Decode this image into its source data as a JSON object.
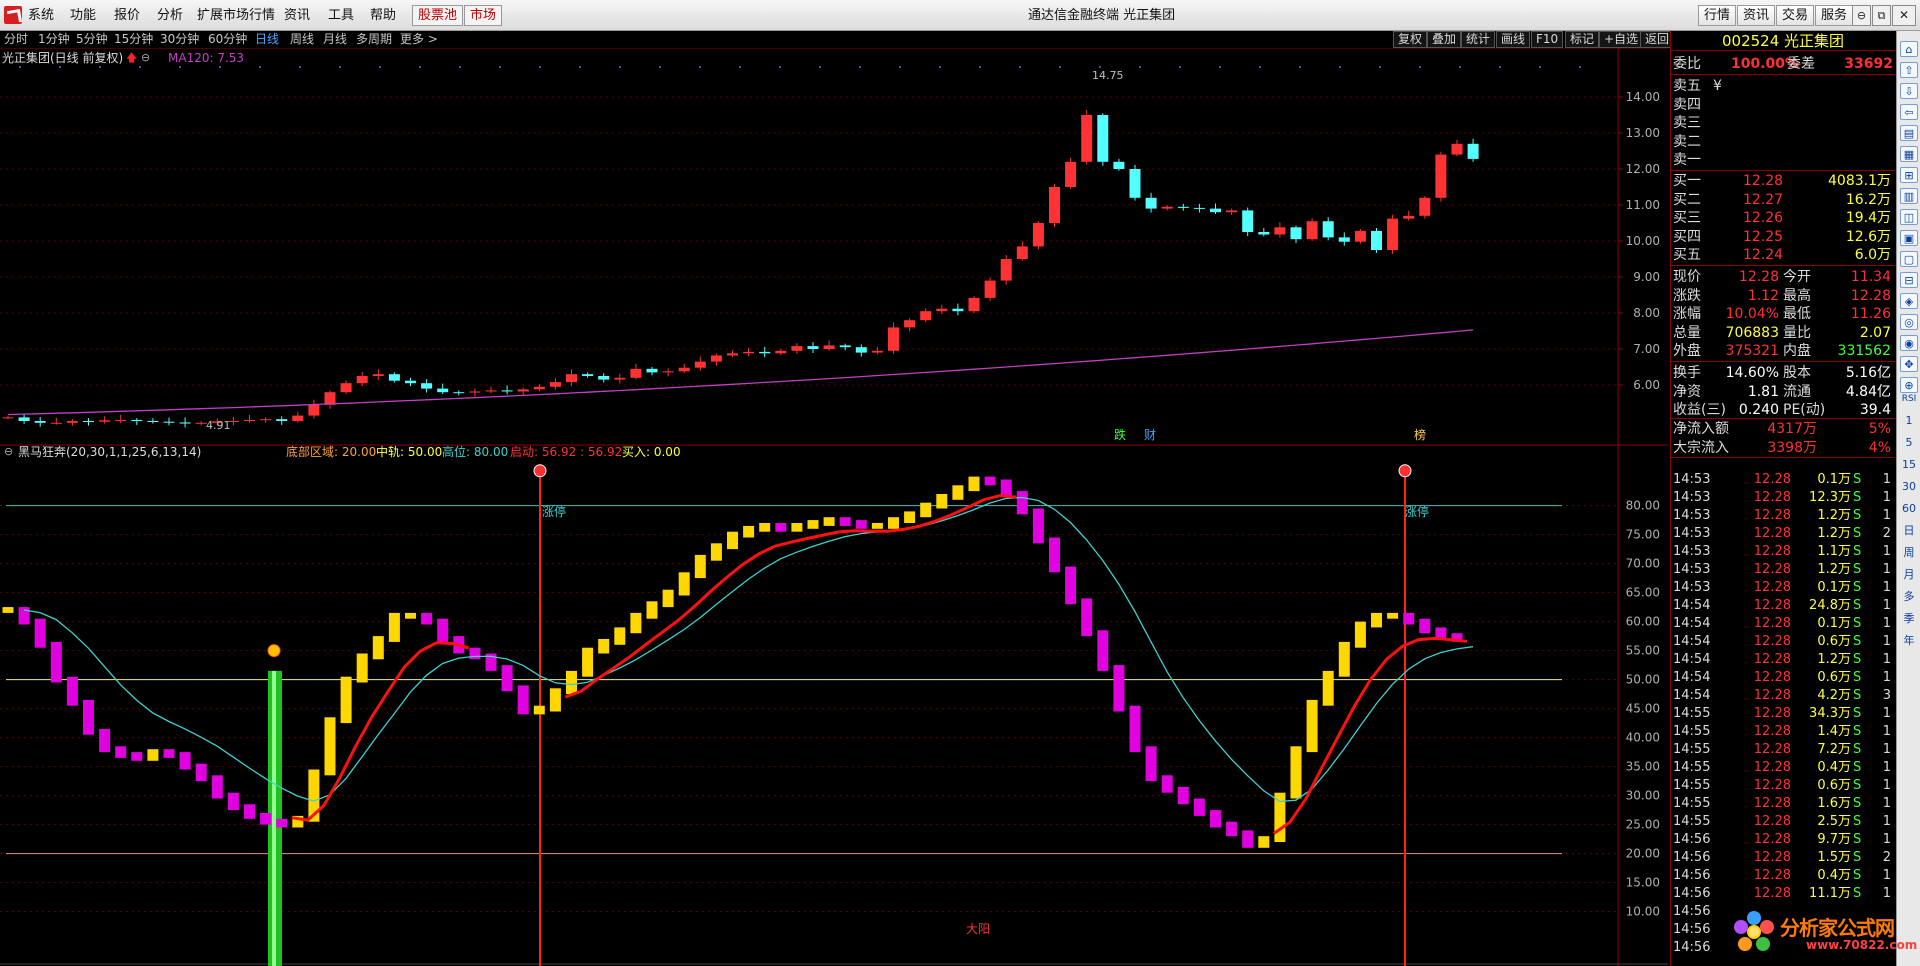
{
  "menubar": {
    "items": [
      "系统",
      "功能",
      "报价",
      "分析",
      "扩展市场行情",
      "资讯",
      "工具",
      "帮助"
    ],
    "pool_label": "股票池",
    "market_label": "市场",
    "window_title": "通达信金融终端  光正集团",
    "right_buttons": [
      "行情",
      "资讯",
      "交易",
      "服务"
    ]
  },
  "periods": {
    "items": [
      "分时",
      "1分钟",
      "5分钟",
      "15分钟",
      "30分钟",
      "60分钟",
      "日线",
      "周线",
      "月线",
      "多周期",
      "更多 >"
    ],
    "active": "日线"
  },
  "tools": [
    "复权",
    "叠加",
    "统计",
    "画线",
    "F10",
    "标记",
    "+自选",
    "返回"
  ],
  "main_header": {
    "stock": "光正集团(日线 前复权)",
    "ma": "MA120: 7.53"
  },
  "annotations": {
    "high": "14.75",
    "low": "4.91",
    "markers": [
      "跌",
      "财",
      "榜"
    ]
  },
  "indicator": {
    "name": "黑马狂奔(20,30,1,1,25,6,13,14)",
    "bottom_label": "底部区域: 20.00",
    "mid_label": "中轨: 50.00",
    "high_label": "高位: 80.00",
    "launch_label": "启动: 56.92 : 56.92",
    "buy_label": "买入: 0.00",
    "limit_up": "涨停",
    "big_yang": "大阳"
  },
  "colors": {
    "up": "#ff3333",
    "down": "#54ffff",
    "ma120": "#c040c0",
    "yellow": "#ffd700",
    "magenta": "#e000e0",
    "red_line": "#ff1010",
    "cyan_line": "#40d0d0"
  },
  "chart_data": [
    {
      "type": "candlestick",
      "title": "光正集团(日线 前复权)",
      "yaxis_ticks": [
        "14.00",
        "13.00",
        "12.00",
        "11.00",
        "10.00",
        "9.00",
        "8.00",
        "7.00",
        "6.00"
      ],
      "ylim": [
        5.4,
        14.9
      ],
      "series": [
        {
          "name": "K线",
          "close": [
            5.1,
            5.0,
            4.95,
            4.95,
            5.0,
            4.98,
            5.02,
            5.03,
            5.0,
            4.98,
            4.96,
            4.93,
            4.95,
            4.99,
            5.0,
            5.03,
            5.05,
            5.0,
            5.15,
            5.45,
            5.8,
            6.05,
            6.25,
            6.3,
            6.12,
            6.05,
            5.9,
            5.8,
            5.79,
            5.82,
            5.85,
            5.82,
            5.88,
            5.95,
            6.08,
            6.3,
            6.25,
            6.15,
            6.2,
            6.45,
            6.35,
            6.38,
            6.48,
            6.65,
            6.82,
            6.88,
            6.92,
            6.88,
            6.95,
            7.08,
            7.0,
            7.1,
            7.05,
            6.9,
            6.95,
            7.6,
            7.8,
            8.05,
            8.12,
            8.05,
            8.42,
            8.9,
            9.5,
            9.85,
            10.5,
            11.5,
            12.2,
            13.5,
            12.2,
            12.0,
            11.2,
            10.9,
            10.95,
            10.92,
            10.9,
            10.8,
            10.85,
            10.25,
            10.18,
            10.38,
            10.05,
            10.55,
            10.1,
            9.98,
            10.28,
            9.75,
            10.62,
            10.7,
            11.2,
            12.4,
            12.7,
            12.28
          ]
        },
        {
          "name": "MA120",
          "values": [
            5.18,
            7.53
          ]
        }
      ]
    },
    {
      "type": "line",
      "title": "黑马狂奔(20,30,1,1,25,6,13,14)",
      "yaxis_ticks": [
        "80.00",
        "75.00",
        "70.00",
        "65.00",
        "60.00",
        "55.00",
        "50.00",
        "45.00",
        "40.00",
        "35.00",
        "30.00",
        "25.00",
        "20.00",
        "15.00",
        "10.00"
      ],
      "ylim": [
        5,
        87
      ],
      "levels": [
        20,
        50,
        80
      ],
      "series": [
        {
          "name": "黑马狂奔",
          "values": [
            62,
            60,
            56,
            50,
            46,
            41,
            38,
            37,
            36.5,
            37.5,
            37,
            35,
            33,
            30,
            28,
            26.5,
            25.5,
            25,
            26,
            34,
            43,
            50,
            54,
            57,
            61,
            61,
            60,
            57,
            55,
            54,
            52,
            48.5,
            44.5,
            45,
            48,
            51,
            55,
            56.5,
            58.5,
            61,
            63,
            65,
            68,
            71,
            73,
            75,
            76,
            76.5,
            76,
            76.5,
            77,
            77.5,
            77,
            76.5,
            76.5,
            77.5,
            78.5,
            80,
            81.5,
            83,
            84.5,
            84,
            82,
            79,
            74,
            69,
            63.5,
            58,
            52,
            45,
            38,
            33,
            31,
            29,
            27,
            25,
            23.5,
            21.5,
            22.5,
            30,
            38,
            46,
            51,
            56,
            59.5,
            61,
            61,
            60,
            58.5,
            57.5,
            57
          ]
        }
      ]
    }
  ],
  "right_panel": {
    "code": "002524 光正集团",
    "wb_label": "委比",
    "wb_value": "100.00%",
    "wc_label": "委差",
    "wc_value": "33692",
    "sell": [
      {
        "label": "卖五",
        "price": "¥",
        "vol": ""
      },
      {
        "label": "卖四",
        "price": "",
        "vol": ""
      },
      {
        "label": "卖三",
        "price": "",
        "vol": ""
      },
      {
        "label": "卖二",
        "price": "",
        "vol": ""
      },
      {
        "label": "卖一",
        "price": "",
        "vol": ""
      }
    ],
    "buy": [
      {
        "label": "买一",
        "price": "12.28",
        "vol": "4083.1万"
      },
      {
        "label": "买二",
        "price": "12.27",
        "vol": "16.2万"
      },
      {
        "label": "买三",
        "price": "12.26",
        "vol": "19.4万"
      },
      {
        "label": "买四",
        "price": "12.25",
        "vol": "12.6万"
      },
      {
        "label": "买五",
        "price": "12.24",
        "vol": "6.0万"
      }
    ],
    "stats": [
      {
        "l1": "现价",
        "v1": "12.28",
        "l2": "今开",
        "v2": "11.34"
      },
      {
        "l1": "涨跌",
        "v1": "1.12",
        "l2": "最高",
        "v2": "12.28"
      },
      {
        "l1": "涨幅",
        "v1": "10.04%",
        "l2": "最低",
        "v2": "11.26"
      },
      {
        "l1": "总量",
        "v1": "706883",
        "l2": "量比",
        "v2": "2.07"
      },
      {
        "l1": "外盘",
        "v1": "375321",
        "l2": "内盘",
        "v2": "331562"
      }
    ],
    "stats2": [
      {
        "l1": "换手",
        "v1": "14.60%",
        "l2": "股本",
        "v2": "5.16亿"
      },
      {
        "l1": "净资",
        "v1": "1.81",
        "l2": "流通",
        "v2": "4.84亿"
      },
      {
        "l1": "收益(三)",
        "v1": "0.240",
        "l2": "PE(动)",
        "v2": "39.4"
      }
    ],
    "flows": [
      {
        "label": "净流入额",
        "value": "4317万",
        "pct": "5%"
      },
      {
        "label": "大宗流入",
        "value": "3398万",
        "pct": "4%"
      }
    ],
    "ticks": [
      {
        "t": "14:53",
        "p": "12.28",
        "v": "0.1万",
        "s": "S",
        "n": "1"
      },
      {
        "t": "14:53",
        "p": "12.28",
        "v": "12.3万",
        "s": "S",
        "n": "1"
      },
      {
        "t": "14:53",
        "p": "12.28",
        "v": "1.2万",
        "s": "S",
        "n": "1"
      },
      {
        "t": "14:53",
        "p": "12.28",
        "v": "1.2万",
        "s": "S",
        "n": "2"
      },
      {
        "t": "14:53",
        "p": "12.28",
        "v": "1.1万",
        "s": "S",
        "n": "1"
      },
      {
        "t": "14:53",
        "p": "12.28",
        "v": "1.2万",
        "s": "S",
        "n": "1"
      },
      {
        "t": "14:53",
        "p": "12.28",
        "v": "0.1万",
        "s": "S",
        "n": "1"
      },
      {
        "t": "14:54",
        "p": "12.28",
        "v": "24.8万",
        "s": "S",
        "n": "1"
      },
      {
        "t": "14:54",
        "p": "12.28",
        "v": "0.1万",
        "s": "S",
        "n": "1"
      },
      {
        "t": "14:54",
        "p": "12.28",
        "v": "0.6万",
        "s": "S",
        "n": "1"
      },
      {
        "t": "14:54",
        "p": "12.28",
        "v": "1.2万",
        "s": "S",
        "n": "1"
      },
      {
        "t": "14:54",
        "p": "12.28",
        "v": "0.6万",
        "s": "S",
        "n": "1"
      },
      {
        "t": "14:54",
        "p": "12.28",
        "v": "4.2万",
        "s": "S",
        "n": "3"
      },
      {
        "t": "14:55",
        "p": "12.28",
        "v": "34.3万",
        "s": "S",
        "n": "1"
      },
      {
        "t": "14:55",
        "p": "12.28",
        "v": "1.4万",
        "s": "S",
        "n": "1"
      },
      {
        "t": "14:55",
        "p": "12.28",
        "v": "7.2万",
        "s": "S",
        "n": "1"
      },
      {
        "t": "14:55",
        "p": "12.28",
        "v": "0.4万",
        "s": "S",
        "n": "1"
      },
      {
        "t": "14:55",
        "p": "12.28",
        "v": "0.6万",
        "s": "S",
        "n": "1"
      },
      {
        "t": "14:55",
        "p": "12.28",
        "v": "1.6万",
        "s": "S",
        "n": "1"
      },
      {
        "t": "14:55",
        "p": "12.28",
        "v": "2.5万",
        "s": "S",
        "n": "1"
      },
      {
        "t": "14:56",
        "p": "12.28",
        "v": "9.7万",
        "s": "S",
        "n": "1"
      },
      {
        "t": "14:56",
        "p": "12.28",
        "v": "1.5万",
        "s": "S",
        "n": "2"
      },
      {
        "t": "14:56",
        "p": "12.28",
        "v": "0.4万",
        "s": "S",
        "n": "1"
      },
      {
        "t": "14:56",
        "p": "12.28",
        "v": "11.1万",
        "s": "S",
        "n": "1"
      },
      {
        "t": "14:56",
        "p": "",
        "v": "",
        "s": "",
        "n": ""
      },
      {
        "t": "14:56",
        "p": "",
        "v": "",
        "s": "",
        "n": ""
      },
      {
        "t": "14:56",
        "p": "",
        "v": "",
        "s": "",
        "n": ""
      }
    ]
  },
  "toolcol": {
    "items": [
      "RSI",
      "1",
      "5",
      "15",
      "30",
      "60",
      "日",
      "周",
      "月",
      "多",
      "季",
      "年"
    ]
  },
  "watermark": {
    "title": "分析家公式网",
    "url": "www.70822.com"
  }
}
